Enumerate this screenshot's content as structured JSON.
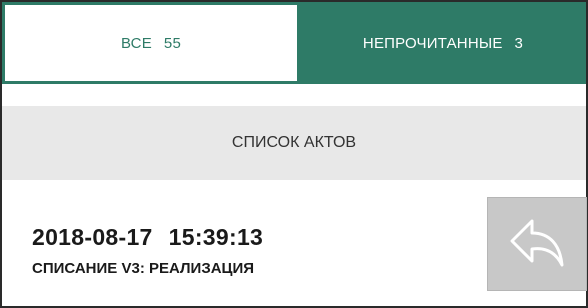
{
  "tabs": {
    "all": {
      "label": "ВСЕ",
      "count": "55"
    },
    "unread": {
      "label": "НЕПРОЧИТАННЫЕ",
      "count": "3"
    }
  },
  "list": {
    "title": "СПИСОК АКТОВ"
  },
  "items": [
    {
      "date": "2018-08-17",
      "time": "15:39:13",
      "type": "СПИСАНИЕ V3: РЕАЛИЗАЦИЯ",
      "action_icon": "reply-icon"
    }
  ],
  "colors": {
    "accent": "#2e7b67",
    "header_bg": "#e8e8e8",
    "button_bg": "#c8c8c8"
  }
}
